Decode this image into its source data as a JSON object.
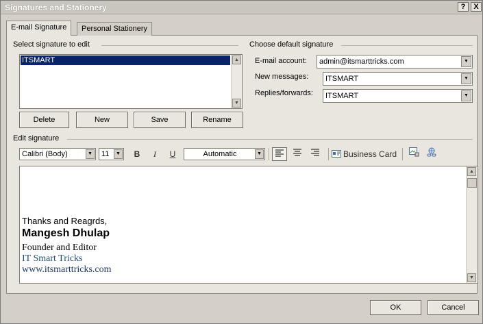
{
  "window": {
    "title": "Signatures and Stationery",
    "help_label": "?",
    "close_label": "X"
  },
  "tabs": [
    {
      "label": "E-mail Signature",
      "active": true
    },
    {
      "label": "Personal Stationery",
      "active": false
    }
  ],
  "select_signature": {
    "group_label": "Select signature to edit",
    "items": [
      "ITSMART"
    ],
    "buttons": [
      "Delete",
      "New",
      "Save",
      "Rename"
    ]
  },
  "default_signature": {
    "group_label": "Choose default signature",
    "email_account_label": "E-mail account:",
    "email_account_value": "admin@itsmarttricks.com",
    "new_messages_label": "New messages:",
    "new_messages_value": "ITSMART",
    "replies_label": "Replies/forwards:",
    "replies_value": "ITSMART"
  },
  "edit_signature": {
    "group_label": "Edit signature",
    "font_name": "Calibri (Body)",
    "font_size": "11",
    "bold_label": "B",
    "italic_label": "I",
    "underline_label": "U",
    "color_label": "Automatic",
    "business_card_label": "Business Card",
    "content": {
      "line1": "Thanks and Reagrds,",
      "line2": "Mangesh Dhulap",
      "line3": "Founder and Editor",
      "line4": "IT Smart Tricks",
      "line5": "www.itsmarttricks.com"
    },
    "link_color": "#1f4e79"
  },
  "footer": {
    "ok_label": "OK",
    "cancel_label": "Cancel"
  },
  "icons": {
    "scroll_up": "up-arrow-icon",
    "scroll_down": "down-arrow-icon",
    "dropdown": "chevron-down-icon",
    "align_left": "align-left-icon",
    "align_center": "align-center-icon",
    "align_right": "align-right-icon",
    "business_card": "business-card-icon",
    "insert_picture": "insert-picture-icon",
    "hyperlink": "hyperlink-icon"
  }
}
